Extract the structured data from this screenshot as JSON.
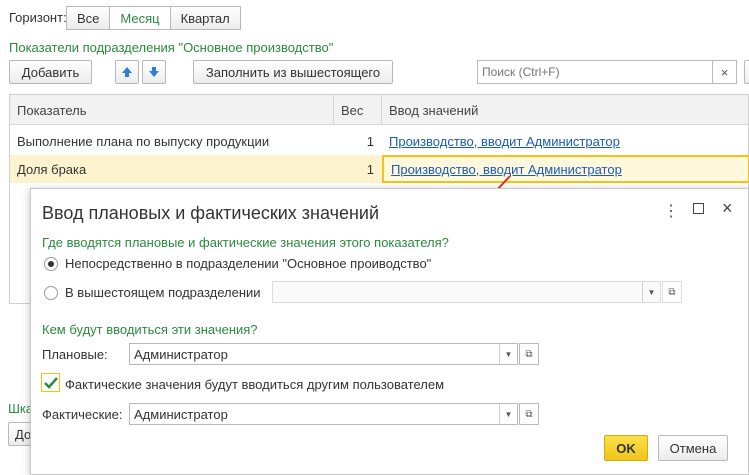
{
  "horizon": {
    "label": "Горизонт:",
    "options": [
      "Все",
      "Месяц",
      "Квартал"
    ],
    "active_index": 1
  },
  "section_title": "Показатели подразделения \"Основное производство\"",
  "toolbar": {
    "add_label": "Добавить",
    "fill_label": "Заполнить из вышестоящего",
    "search_placeholder": "Поиск (Ctrl+F)",
    "clear_glyph": "×"
  },
  "table": {
    "columns": [
      "Показатель",
      "Вес",
      "Ввод значений"
    ],
    "rows": [
      {
        "indicator": "Выполнение плана по выпуску продукции",
        "weight": "1",
        "entry": "Производство, вводит Администратор"
      },
      {
        "indicator": "Доля брака",
        "weight": "1",
        "entry": "Производство, вводит Администратор"
      }
    ]
  },
  "behind_text": {
    "label_partial": "Шка",
    "button_partial": "До"
  },
  "dialog": {
    "title": "Ввод плановых и фактических значений",
    "question_where": "Где вводятся плановые и фактические значения этого показателя?",
    "option_direct": "Непосредственно в подразделении \"Основное проиводство\"",
    "option_higher": "В вышестоящем подразделении",
    "question_who": "Кем будут вводиться эти значения?",
    "planned_label": "Плановые:",
    "planned_value": "Администратор",
    "checkbox_label": "Фактические значения будут вводиться другим пользователем",
    "actual_label": "Фактические:",
    "actual_value": "Администратор",
    "ok_label": "OK",
    "cancel_label": "Отмена"
  },
  "colors": {
    "accent_green": "#2b8a3e",
    "link_blue": "#1a5cb8",
    "ok_yellow": "#f5d31a",
    "selected_row": "#fdf3cf",
    "arrow_red": "#d9322b"
  }
}
